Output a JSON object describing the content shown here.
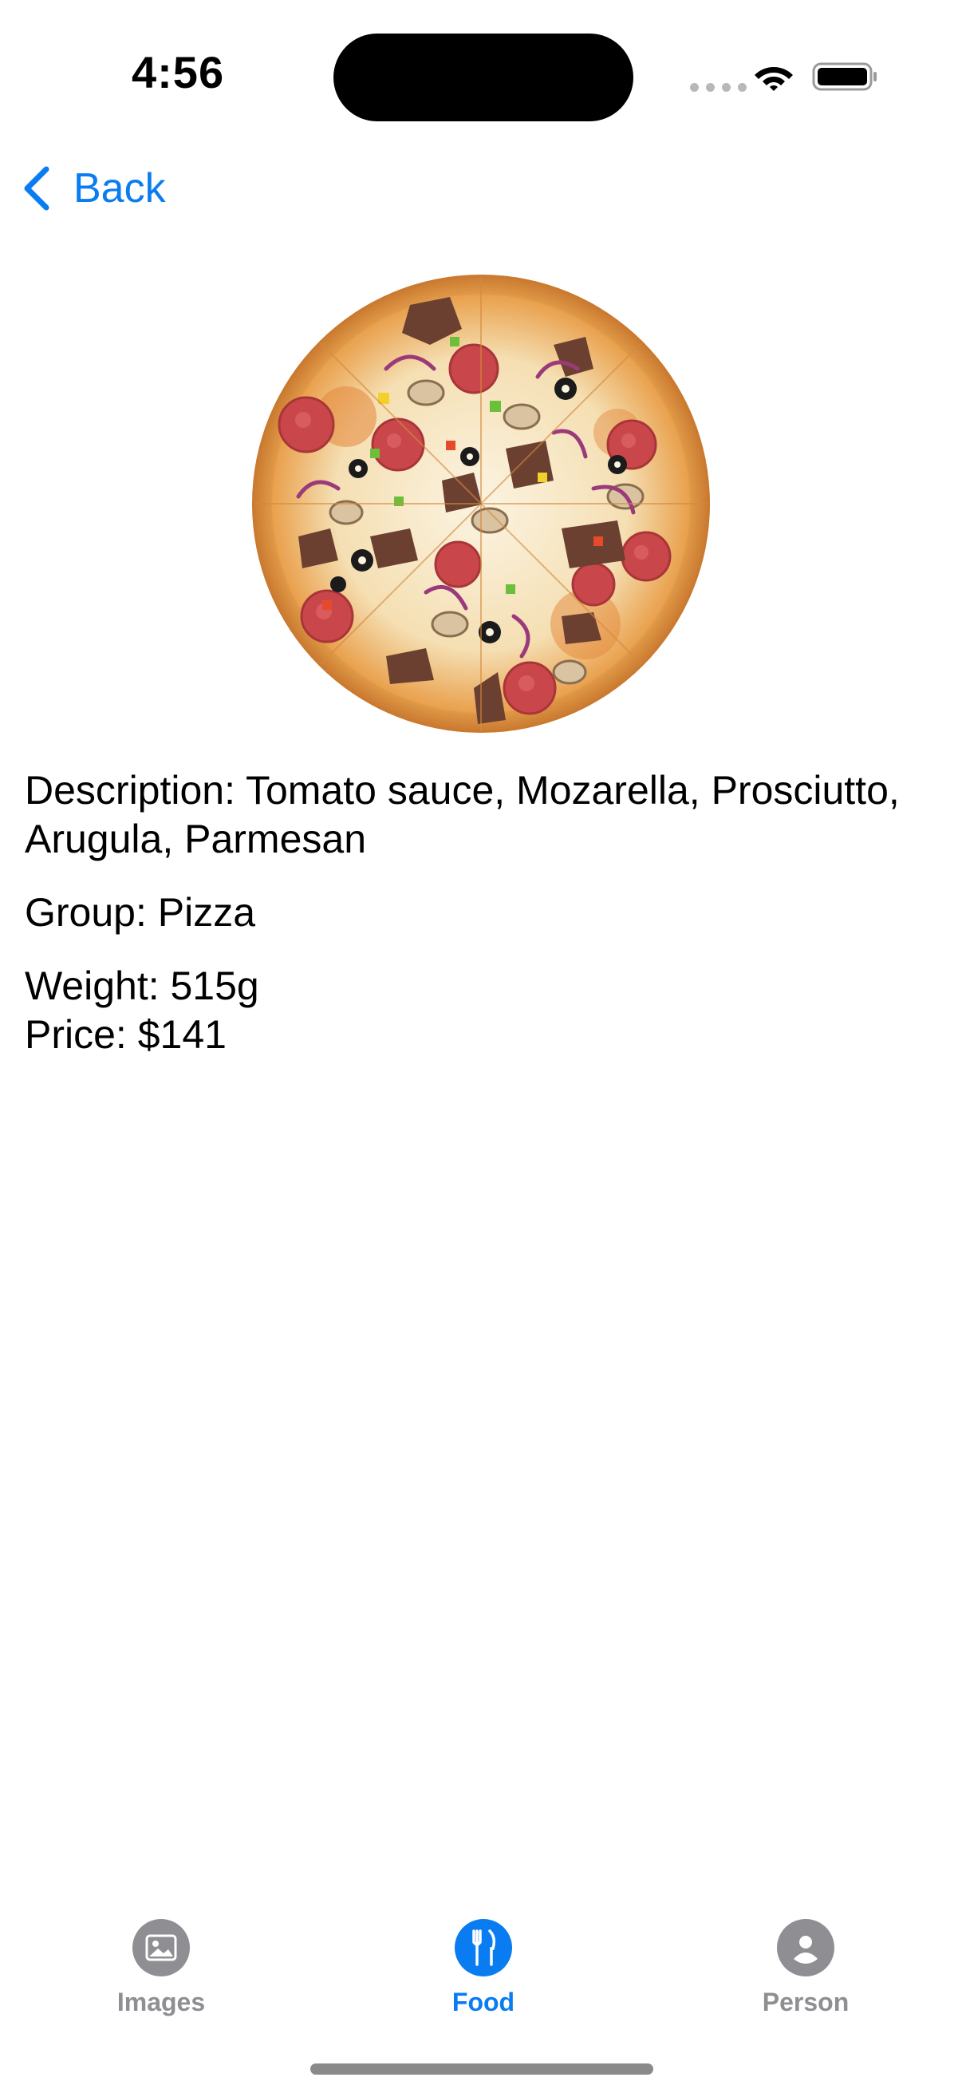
{
  "status_bar": {
    "time": "4:56",
    "icons": [
      "signal-icon",
      "wifi-icon",
      "battery-icon"
    ]
  },
  "nav": {
    "back_label": "Back",
    "back_icon": "chevron-left-icon"
  },
  "product": {
    "image": "pizza-image",
    "description": "Description: Tomato sauce, Mozarella, Prosciutto, Arugula, Parmesan",
    "group": "Group: Pizza",
    "weight": "Weight: 515g",
    "price": "Price: $141"
  },
  "tab_bar": {
    "tabs": [
      {
        "label": "Images",
        "icon": "photo-icon",
        "active": false
      },
      {
        "label": "Food",
        "icon": "fork-knife-icon",
        "active": true
      },
      {
        "label": "Person",
        "icon": "person-icon",
        "active": false
      }
    ]
  },
  "colors": {
    "accent": "#0a7cf2",
    "inactive": "#8e8e93",
    "background": "#ffffff",
    "text": "#000000"
  }
}
